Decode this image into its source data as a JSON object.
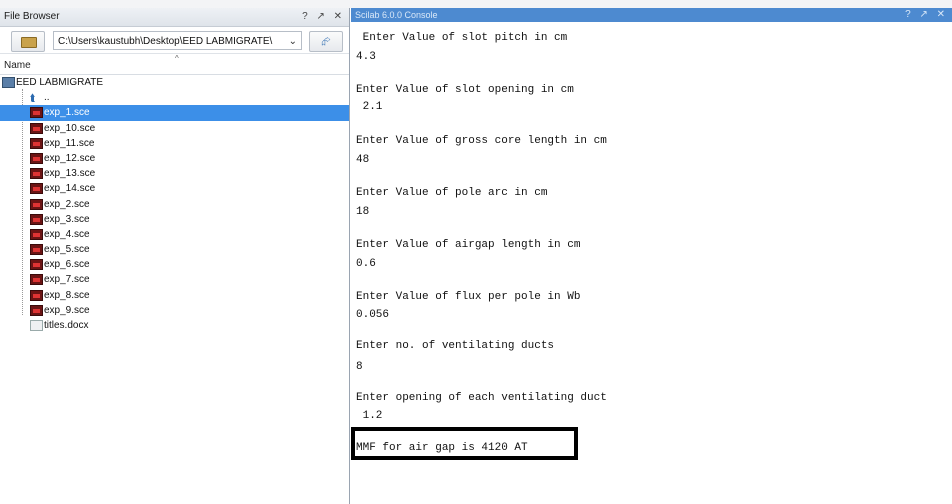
{
  "file_browser": {
    "title": "File Browser",
    "window_controls": "? ↗ ✕",
    "path": "C:\\Users\\kaustubh\\Desktop\\EED LABMIGRATE\\",
    "column_header": "Name",
    "root_folder": "EED LABMIGRATE",
    "parent_entry": "..",
    "selected_file": "exp_1.sce",
    "files": [
      "exp_1.sce",
      "exp_10.sce",
      "exp_11.sce",
      "exp_12.sce",
      "exp_13.sce",
      "exp_14.sce",
      "exp_2.sce",
      "exp_3.sce",
      "exp_4.sce",
      "exp_5.sce",
      "exp_6.sce",
      "exp_7.sce",
      "exp_8.sce",
      "exp_9.sce",
      "titles.docx"
    ]
  },
  "console": {
    "title": "Scilab 6.0.0 Console",
    "window_controls": "? ↗ ✕",
    "lines": [
      " Enter Value of slot pitch in cm",
      "4.3",
      "Enter Value of slot opening in cm",
      " 2.1",
      "Enter Value of gross core length in cm",
      "48",
      "Enter Value of pole arc in cm",
      "18",
      "Enter Value of airgap length in cm",
      "0.6",
      "Enter Value of flux per pole in Wb",
      "0.056",
      "Enter no. of ventilating ducts",
      "8",
      "Enter opening of each ventilating duct",
      " 1.2",
      "MMF for air gap is 4120 AT"
    ]
  }
}
